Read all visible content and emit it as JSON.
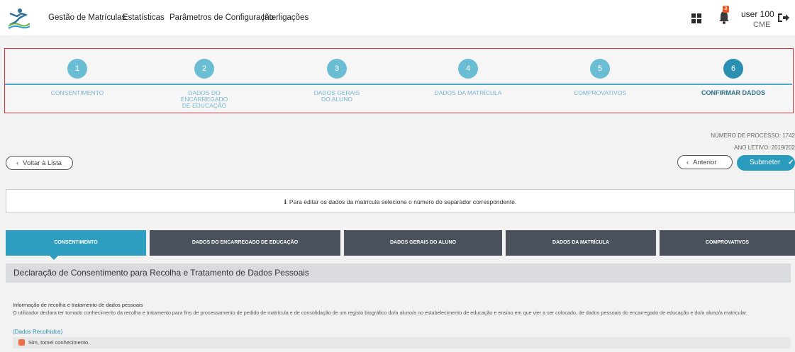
{
  "header": {
    "nav": [
      "Gestão de Matrículas",
      "Estatísticas",
      "Parâmetros de Configuração",
      "Interligações"
    ],
    "notifications_count": "8",
    "user_name": "user 100",
    "user_role": "CME"
  },
  "stepper": {
    "steps": [
      {
        "number": "1",
        "label": "CONSENTIMENTO"
      },
      {
        "number": "2",
        "label": "DADOS DO ENCARREGADO DE EDUCAÇÃO"
      },
      {
        "number": "3",
        "label": "DADOS GERAIS DO ALUNO"
      },
      {
        "number": "4",
        "label": "DADOS DA MATRÍCULA"
      },
      {
        "number": "5",
        "label": "COMPROVATIVOS"
      },
      {
        "number": "6",
        "label": "CONFIRMAR DADOS"
      }
    ],
    "active_step": 6
  },
  "process": {
    "number_text": "NÚMERO DE PROCESSO: 1742",
    "year_text": "ANO LETIVO: 2019/202"
  },
  "actions": {
    "back_label": "Voltar à Lista",
    "previous_label": "Anterior",
    "submit_label": "Submeter"
  },
  "info": {
    "icon": "i",
    "text": "Para editar os dados da matrícula selecione o número do separador correspondente."
  },
  "tabs": [
    "CONSENTIMENTO",
    "DADOS DO ENCARREGADO DE EDUCAÇÃO",
    "DADOS GERAIS DO ALUNO",
    "DADOS DA MATRÍCULA",
    "COMPROVATIVOS"
  ],
  "active_tab": 0,
  "section": {
    "title": "Declaração de Consentimento para Recolha e Tratamento de Dados Pessoais",
    "subheading": "Informação de recolha e tratamento de dados pessoais",
    "paragraph": "O utilizador declara ter tomado conhecimento da recolha e tratamento para fins de processamento de pedido de matrícula e de consolidação de um registo biográfico do/a aluno/a no estabelecimento de educação e ensino em que vier a ser colocado, de dados pessoais do encarregado de educação e do/a aluno/a matricular.",
    "link": "(Dados Recolhidos)",
    "consent_label": "Sim, tomei conhecimento."
  },
  "colors": {
    "accent": "#2f9fc1",
    "tab_dark": "#4a505c",
    "highlight_border": "#e0303a",
    "badge": "#e8572a"
  }
}
